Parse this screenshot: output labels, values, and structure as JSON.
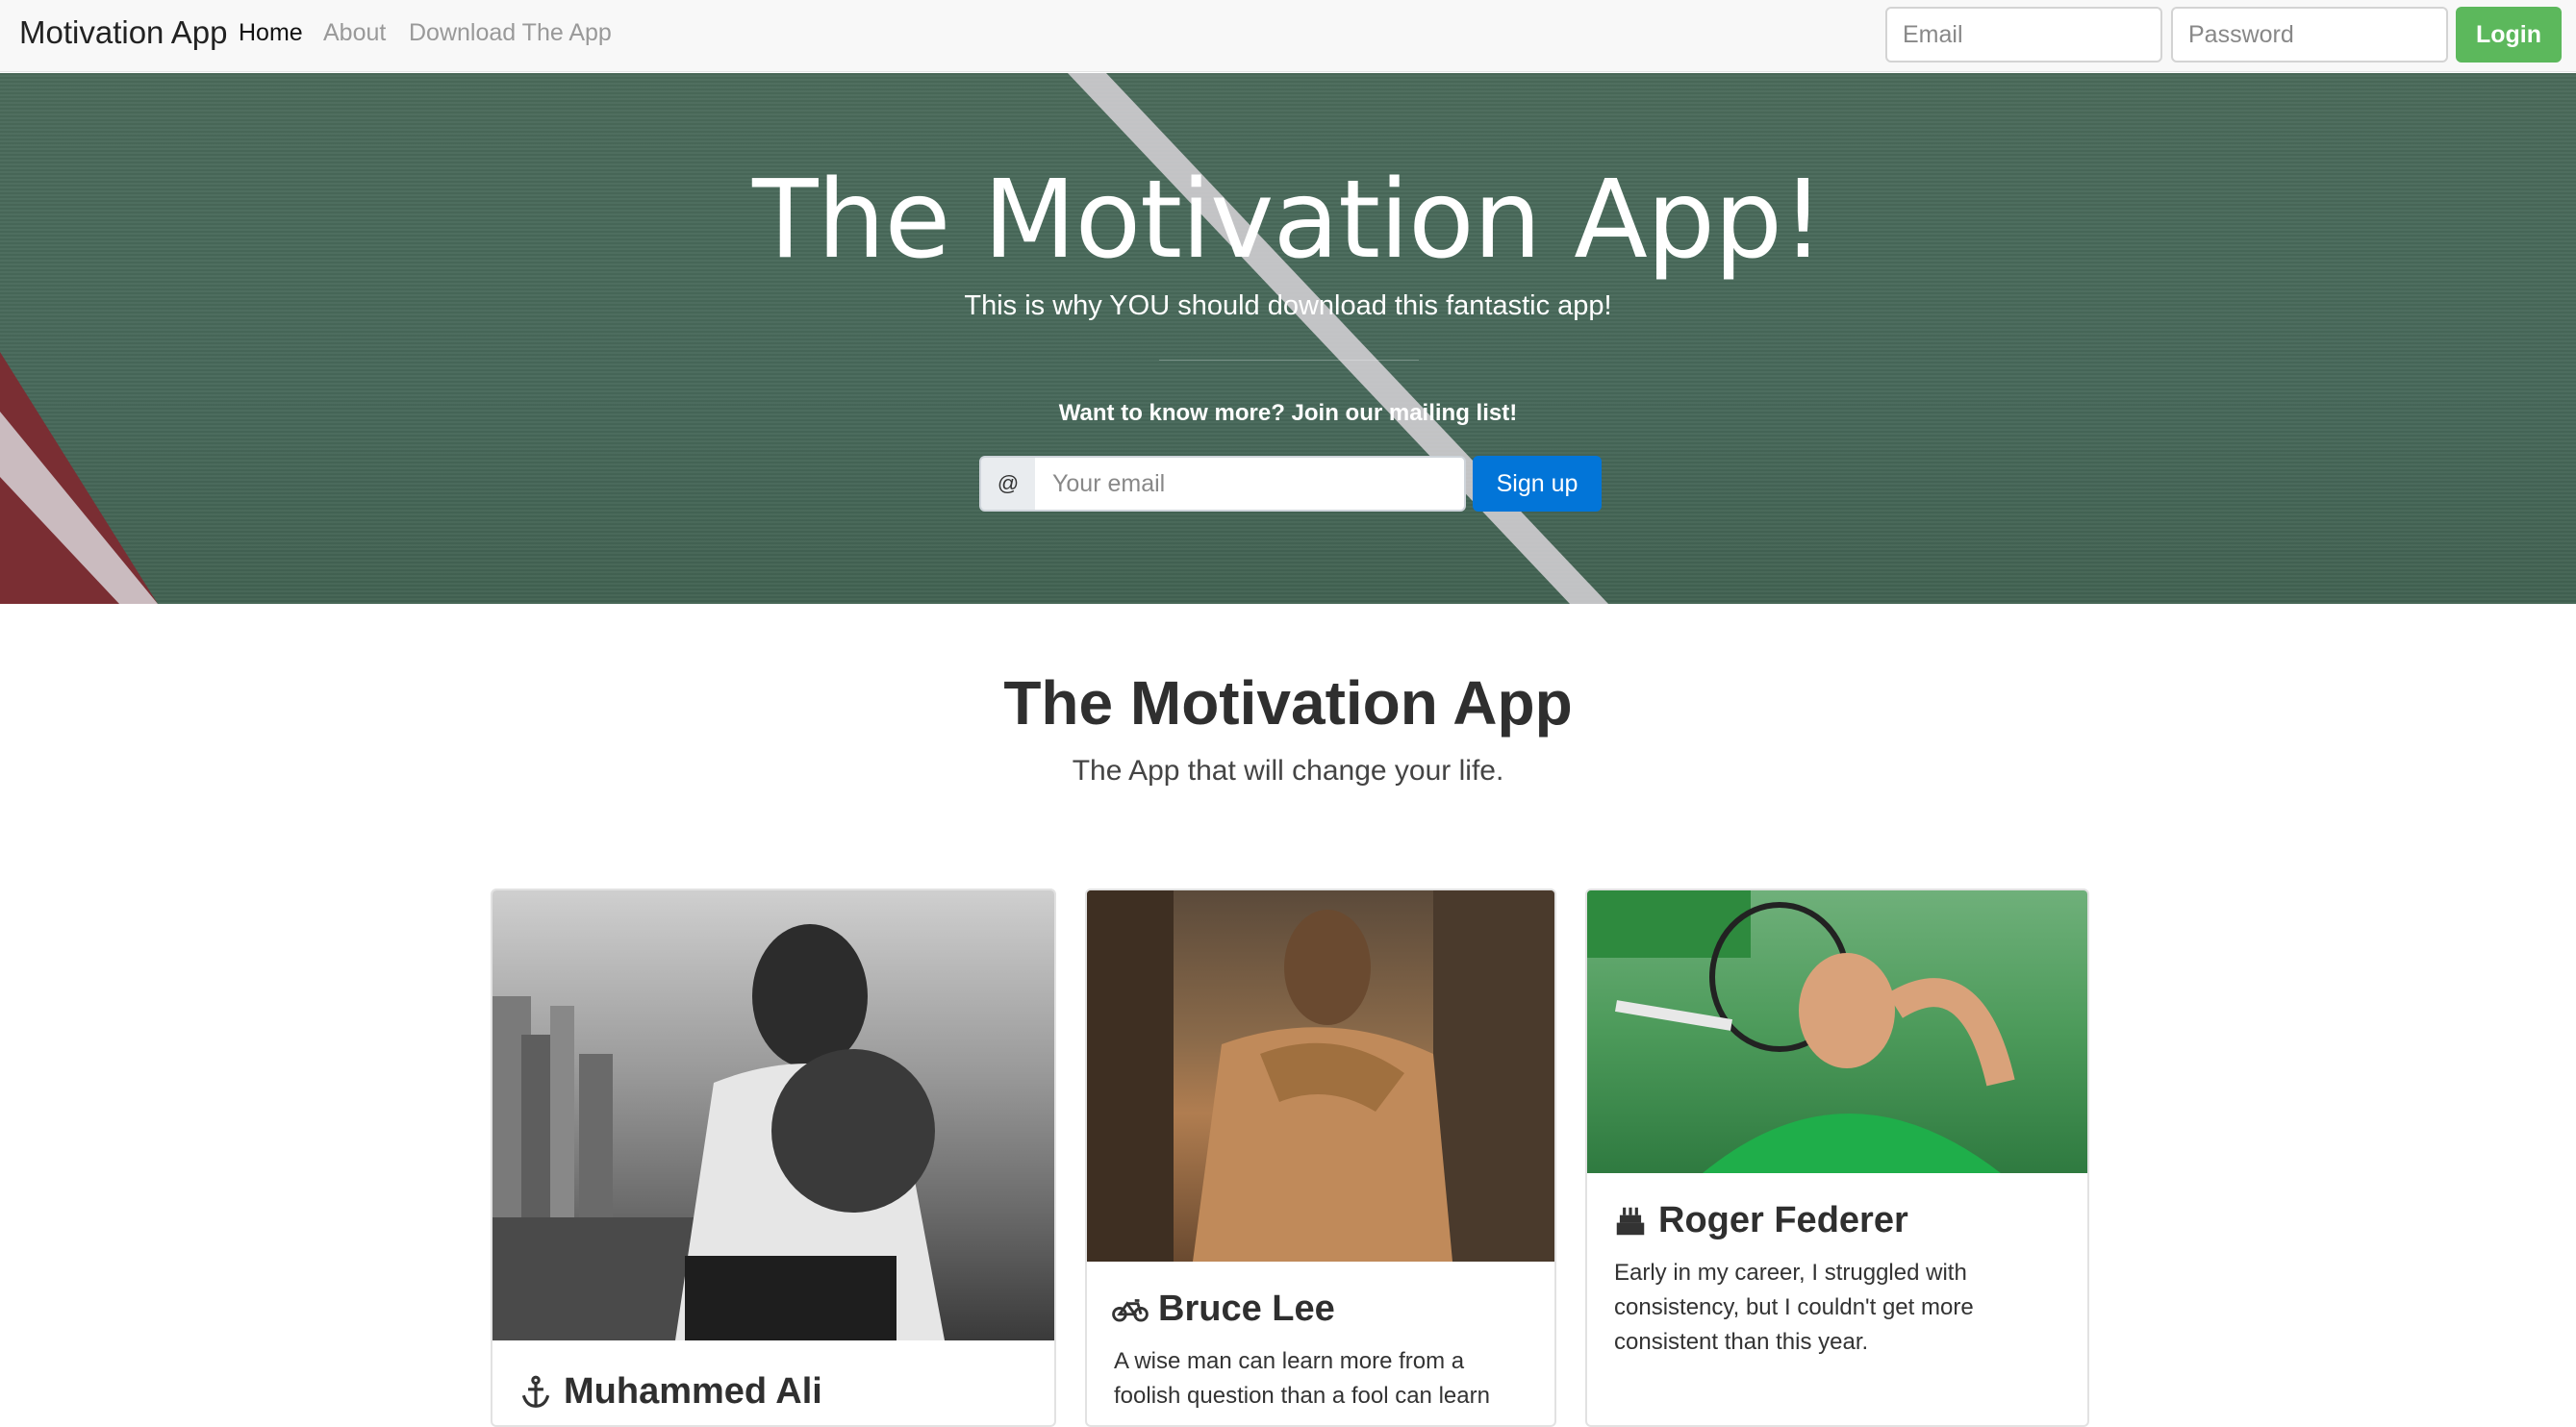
{
  "navbar": {
    "brand": "Motivation App",
    "links": [
      "Home",
      "About",
      "Download The App"
    ],
    "email_placeholder": "Email",
    "password_placeholder": "Password",
    "login_label": "Login"
  },
  "hero": {
    "title": "The Motivation App!",
    "subtitle": "This is why YOU should download this fantastic app!",
    "cta": "Want to know more? Join our mailing list!",
    "addon": "@",
    "email_placeholder": "Your email",
    "signup_label": "Sign up"
  },
  "section": {
    "title": "The Motivation App",
    "subtitle": "The App that will change your life."
  },
  "cards": [
    {
      "name": "Muhammed Ali",
      "icon": "anchor-icon",
      "text": ""
    },
    {
      "name": "Bruce Lee",
      "icon": "bicycle-icon",
      "text": "A wise man can learn more from a foolish question than a fool can learn"
    },
    {
      "name": "Roger Federer",
      "icon": "birthday-cake-icon",
      "text": "Early in my career, I struggled with consistency, but I couldn't get more consistent than this year."
    }
  ],
  "colors": {
    "login": "#5cb85c",
    "signup": "#0275d8",
    "hero_bg": "#47685a"
  }
}
